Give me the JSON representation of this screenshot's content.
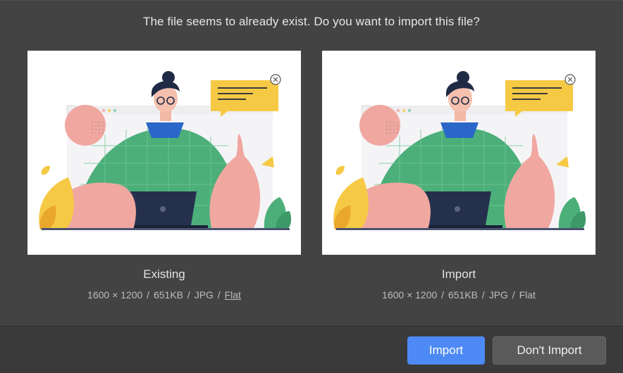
{
  "dialog": {
    "question": "The file seems to already exist. Do you want to import this file?"
  },
  "existing": {
    "label": "Existing",
    "dimensions": "1600 × 1200",
    "size": "651KB",
    "format": "JPG",
    "mode": "Flat"
  },
  "import": {
    "label": "Import",
    "dimensions": "1600 × 1200",
    "size": "651KB",
    "format": "JPG",
    "mode": "Flat"
  },
  "buttons": {
    "import_label": "Import",
    "dont_import_label": "Don't Import"
  },
  "colors": {
    "primary_button": "#4d8af5",
    "dialog_background": "#434343"
  }
}
